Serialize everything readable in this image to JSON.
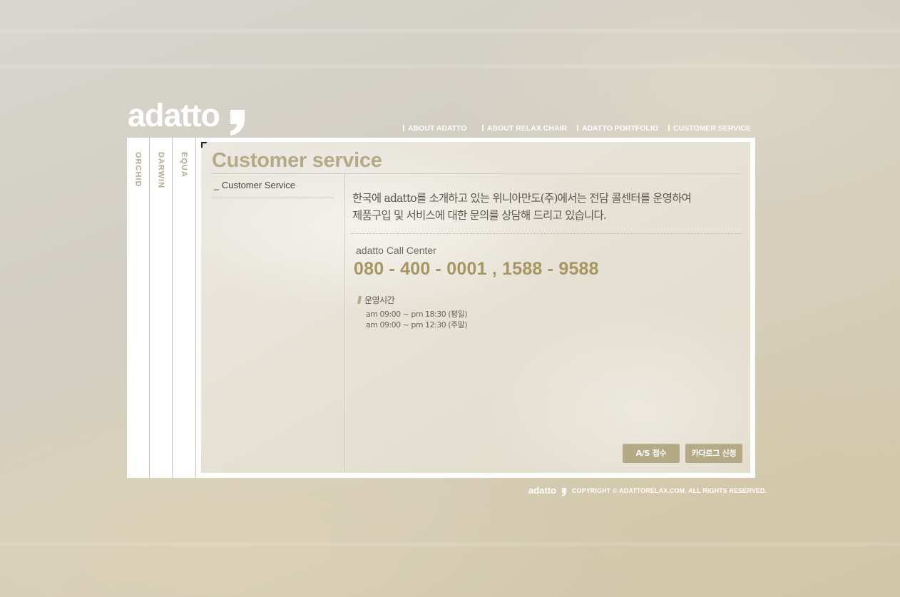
{
  "brand": {
    "logo_text": "adatto"
  },
  "top_nav": [
    {
      "label": "ABOUT ADATTO"
    },
    {
      "label": "ABOUT RELAX CHAIR"
    },
    {
      "label": "ADATTO PORTFOLIO"
    },
    {
      "label": "CUSTOMER SERVICE"
    }
  ],
  "side_tabs": [
    {
      "label": "ORCHID"
    },
    {
      "label": "DARWIN"
    },
    {
      "label": "EQUA"
    }
  ],
  "page": {
    "title": "Customer service"
  },
  "left_menu": [
    {
      "label": "_ Customer Service"
    }
  ],
  "intro": {
    "line1": "한국에 adatto를 소개하고 있는 위니아만도(주)에서는 전담 콜센터를 운영하여",
    "line2": "제품구입 및 서비스에 대한 문의를 상담해 드리고 있습니다."
  },
  "call_center": {
    "label": "adatto Call Center",
    "numbers": "080 - 400 - 0001  ,  1588 - 9588"
  },
  "hours": {
    "heading": "운영시간",
    "weekday": "am 09:00 ~ pm 18:30 (평일)",
    "weekend": "am 09:00 ~ pm 12:30 (주말)"
  },
  "buttons": {
    "as_request": "A/S 접수",
    "catalog_request": "카다로그 신청"
  },
  "footer": {
    "logo_text": "adatto",
    "copyright": "COPYRIGHT ©  ADATTORELAX.COM.  ALL RIGHTS RESERVED."
  },
  "colors": {
    "accent": "#b5aa86",
    "number_gold": "#a8955f",
    "frame_bg": "#ffffff"
  }
}
